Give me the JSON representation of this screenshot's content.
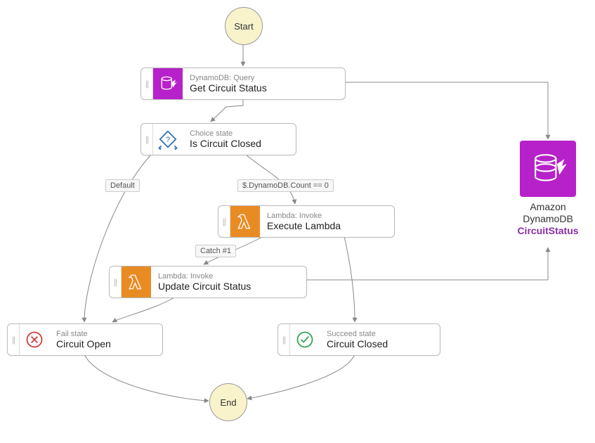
{
  "terminals": {
    "start": "Start",
    "end": "End"
  },
  "states": {
    "get_status": {
      "type": "DynamoDB: Query",
      "title": "Get Circuit Status"
    },
    "is_closed": {
      "type": "Choice state",
      "title": "Is Circuit Closed"
    },
    "execute": {
      "type": "Lambda: Invoke",
      "title": "Execute Lambda"
    },
    "update": {
      "type": "Lambda: Invoke",
      "title": "Update Circuit Status"
    },
    "open": {
      "type": "Fail state",
      "title": "Circuit Open"
    },
    "closed": {
      "type": "Succeed state",
      "title": "Circuit Closed"
    }
  },
  "edge_labels": {
    "default": "Default",
    "count0": "$.DynamoDB.Count == 0",
    "catch1": "Catch #1"
  },
  "resource": {
    "line1": "Amazon",
    "line2": "DynamoDB",
    "sub": "CircuitStatus"
  }
}
